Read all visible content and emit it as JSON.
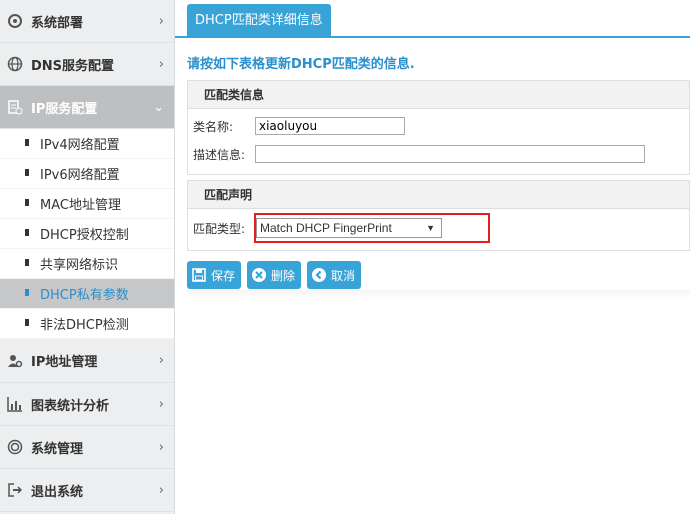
{
  "sidebar": {
    "items": [
      {
        "label": "系统部署",
        "icon": "deploy-icon"
      },
      {
        "label": "DNS服务配置",
        "icon": "globe-icon"
      },
      {
        "label": "IP服务配置",
        "icon": "ip-service-icon",
        "active": true,
        "children": [
          {
            "label": "IPv4网络配置"
          },
          {
            "label": "IPv6网络配置"
          },
          {
            "label": "MAC地址管理"
          },
          {
            "label": "DHCP授权控制"
          },
          {
            "label": "共享网络标识"
          },
          {
            "label": "DHCP私有参数",
            "active": true
          },
          {
            "label": "非法DHCP检测"
          }
        ]
      },
      {
        "label": "IP地址管理",
        "icon": "user-gear-icon"
      },
      {
        "label": "图表统计分析",
        "icon": "chart-icon"
      },
      {
        "label": "系统管理",
        "icon": "settings-icon"
      },
      {
        "label": "退出系统",
        "icon": "logout-icon"
      }
    ]
  },
  "tab": {
    "label": "DHCP匹配类详细信息"
  },
  "hint": "请按如下表格更新DHCP匹配类的信息.",
  "section1": {
    "title": "匹配类信息",
    "name_label": "类名称:",
    "name_value": "xiaoluyou",
    "desc_label": "描述信息:",
    "desc_value": ""
  },
  "section2": {
    "title": "匹配声明",
    "type_label": "匹配类型:",
    "type_value": "Match DHCP FingerPrint"
  },
  "buttons": {
    "save": "保存",
    "delete": "删除",
    "cancel": "取消"
  },
  "colors": {
    "accent": "#38a3d6",
    "highlight": "#e02020",
    "active_text": "#2a8fcc"
  }
}
